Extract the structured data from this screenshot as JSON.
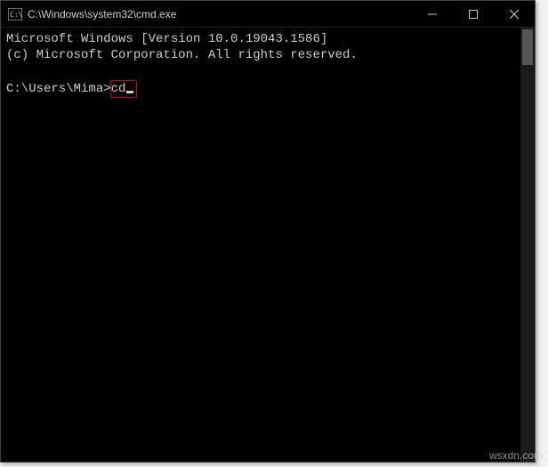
{
  "window": {
    "title": "C:\\Windows\\system32\\cmd.exe"
  },
  "terminal": {
    "line1": "Microsoft Windows [Version 10.0.19043.1586]",
    "line2": "(c) Microsoft Corporation. All rights reserved.",
    "prompt": "C:\\Users\\Mima>",
    "command": "cd"
  },
  "watermark": "wsxdn.com"
}
